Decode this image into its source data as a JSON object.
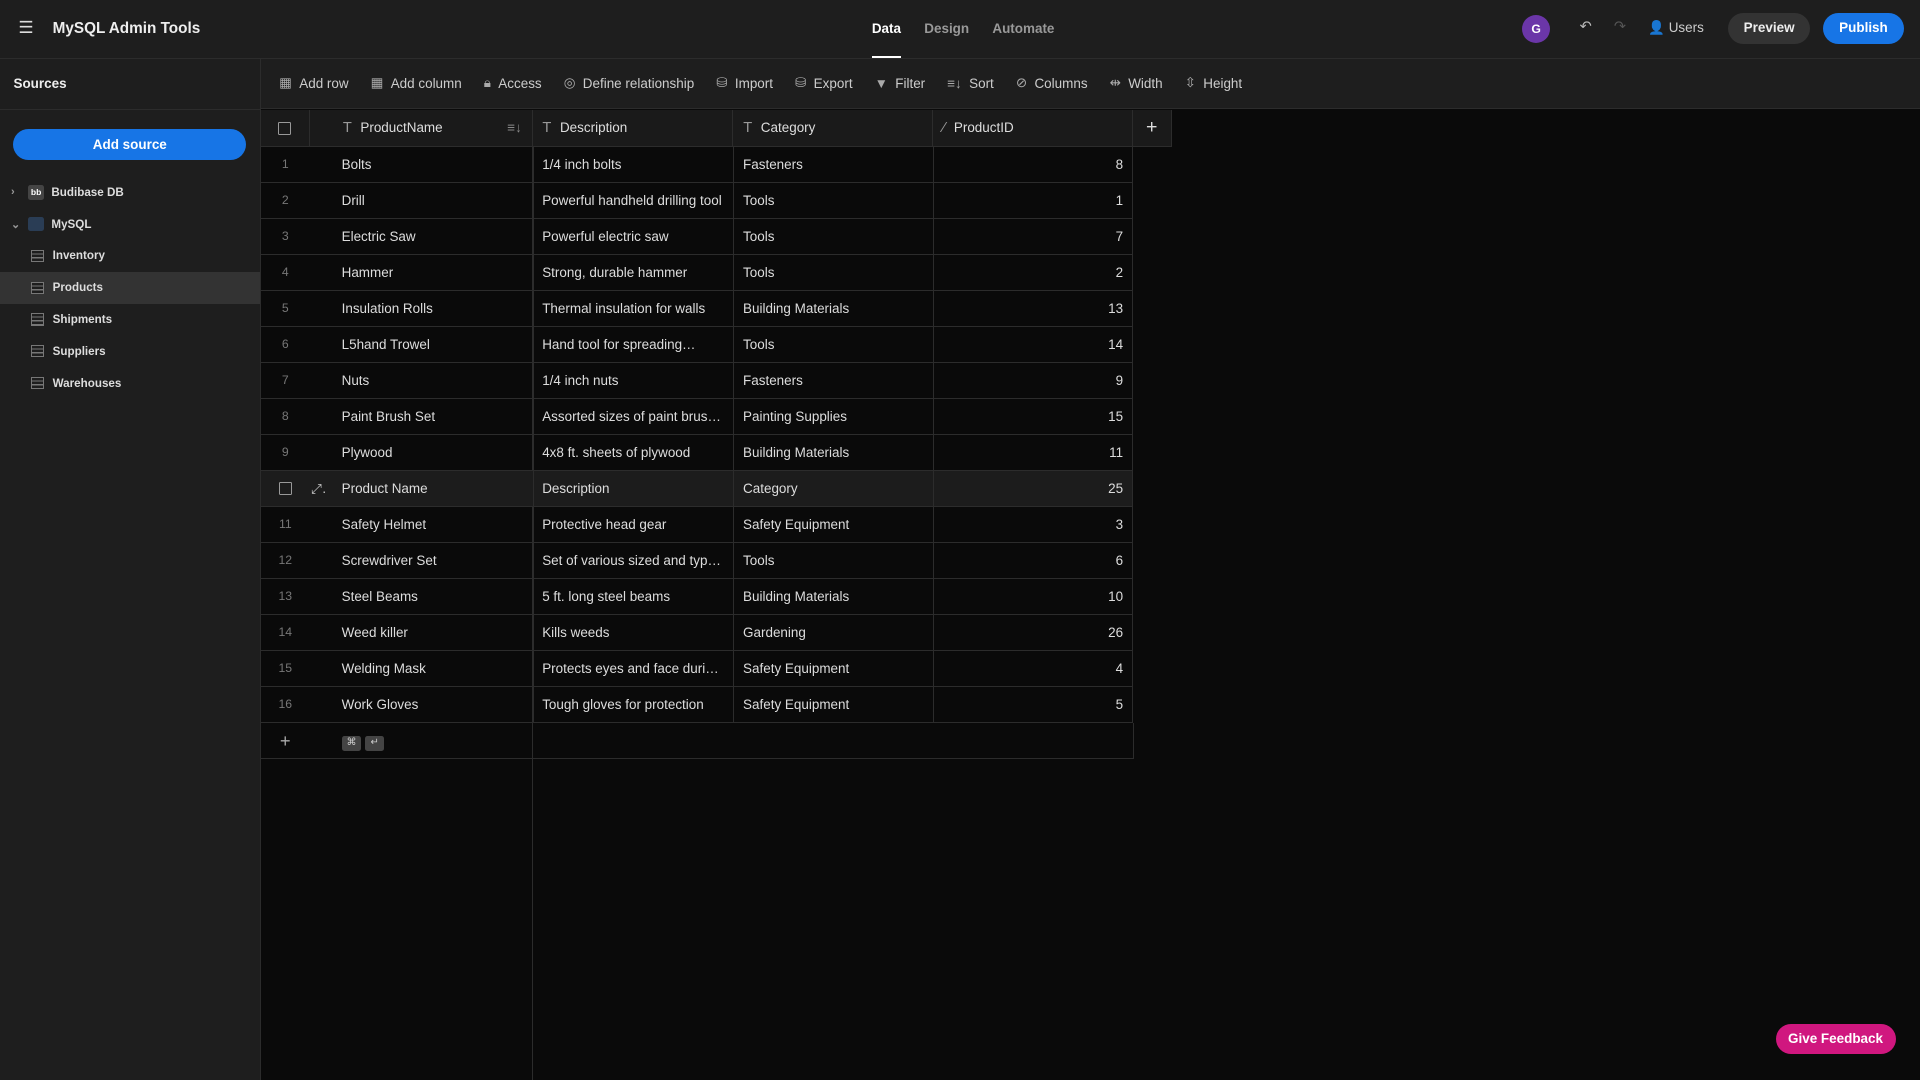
{
  "app": {
    "title": "MySQL Admin Tools",
    "tabs": [
      {
        "label": "Data",
        "active": true
      },
      {
        "label": "Design"
      },
      {
        "label": "Automate"
      }
    ],
    "avatar": "G",
    "users": "Users",
    "preview": "Preview",
    "publish": "Publish"
  },
  "sidebar": {
    "title": "Sources",
    "add_source": "Add source",
    "datasources": [
      {
        "label": "Budibase DB",
        "icon": "bb"
      },
      {
        "label": "MySQL"
      }
    ],
    "tables": [
      "Inventory",
      "Products",
      "Shipments",
      "Suppliers",
      "Warehouses"
    ],
    "selected": "Products"
  },
  "toolbar": [
    "Add row",
    "Add column",
    "Access",
    "Define relationship",
    "Import",
    "Export",
    "Filter",
    "Sort",
    "Columns",
    "Width",
    "Height"
  ],
  "columns": [
    "ProductName",
    "Description",
    "Category",
    "ProductID"
  ],
  "rows": [
    {
      "n": "1",
      "name": "Bolts",
      "desc": "1/4 inch bolts",
      "cat": "Fasteners",
      "id": "8"
    },
    {
      "n": "2",
      "name": "Drill",
      "desc": "Powerful handheld drilling tool",
      "cat": "Tools",
      "id": "1"
    },
    {
      "n": "3",
      "name": "Electric Saw",
      "desc": "Powerful electric saw",
      "cat": "Tools",
      "id": "7"
    },
    {
      "n": "4",
      "name": "Hammer",
      "desc": "Strong, durable hammer",
      "cat": "Tools",
      "id": "2"
    },
    {
      "n": "5",
      "name": "Insulation Rolls",
      "desc": "Thermal insulation for walls",
      "cat": "Building Materials",
      "id": "13"
    },
    {
      "n": "6",
      "name": "L5hand Trowel",
      "desc": "Hand tool for spreading…",
      "cat": "Tools",
      "id": "14"
    },
    {
      "n": "7",
      "name": "Nuts",
      "desc": "1/4 inch nuts",
      "cat": "Fasteners",
      "id": "9"
    },
    {
      "n": "8",
      "name": "Paint Brush Set",
      "desc": "Assorted sizes of paint brushes",
      "cat": "Painting Supplies",
      "id": "15"
    },
    {
      "n": "9",
      "name": "Plywood",
      "desc": "4x8 ft. sheets of plywood",
      "cat": "Building Materials",
      "id": "11"
    },
    {
      "n": "",
      "name": "Product Name",
      "desc": "Description",
      "cat": "Category",
      "id": "25"
    },
    {
      "n": "11",
      "name": "Safety Helmet",
      "desc": "Protective head gear",
      "cat": "Safety Equipment",
      "id": "3"
    },
    {
      "n": "12",
      "name": "Screwdriver Set",
      "desc": "Set of various sized and type…",
      "cat": "Tools",
      "id": "6"
    },
    {
      "n": "13",
      "name": "Steel Beams",
      "desc": "5 ft. long steel beams",
      "cat": "Building Materials",
      "id": "10"
    },
    {
      "n": "14",
      "name": "Weed killer",
      "desc": "Kills weeds",
      "cat": "Gardening",
      "id": "26"
    },
    {
      "n": "15",
      "name": "Welding Mask",
      "desc": "Protects eyes and face durin…",
      "cat": "Safety Equipment",
      "id": "4"
    },
    {
      "n": "16",
      "name": "Work Gloves",
      "desc": "Tough gloves for protection",
      "cat": "Safety Equipment",
      "id": "5"
    }
  ],
  "footer_keys": [
    "⌘",
    "↵"
  ],
  "feedback": "Give Feedback"
}
